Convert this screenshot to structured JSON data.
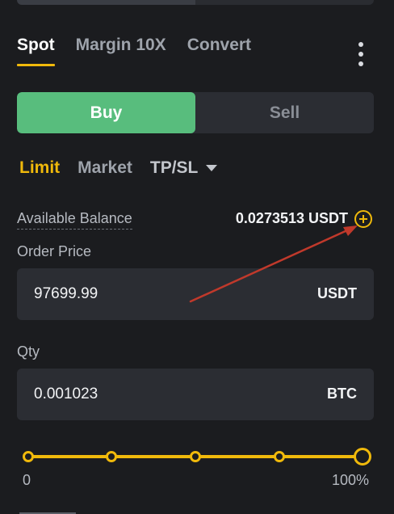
{
  "mode_tabs": [
    {
      "label": "Spot",
      "active": true
    },
    {
      "label": "Margin 10X",
      "active": false
    },
    {
      "label": "Convert",
      "active": false
    }
  ],
  "side_toggle": {
    "buy_label": "Buy",
    "sell_label": "Sell",
    "selected": "Buy"
  },
  "order_types": {
    "limit": "Limit",
    "market": "Market",
    "tpsl": "TP/SL",
    "selected": "Limit"
  },
  "balance": {
    "label": "Available Balance",
    "value": "0.0273513 USDT"
  },
  "order_price": {
    "label": "Order Price",
    "value": "97699.99",
    "unit": "USDT"
  },
  "qty": {
    "label": "Qty",
    "value": "0.001023",
    "unit": "BTC"
  },
  "slider": {
    "min_label": "0",
    "max_label": "100%",
    "percent": 100
  },
  "colors": {
    "accent": "#f0b90b",
    "buy": "#58bd7d",
    "background": "#1b1c1f",
    "field": "#2b2d33",
    "annotation_arrow": "#c0392b"
  },
  "icons": {
    "more": "more-vertical-icon",
    "add_funds": "plus-circle-icon",
    "dropdown": "caret-down-icon"
  }
}
